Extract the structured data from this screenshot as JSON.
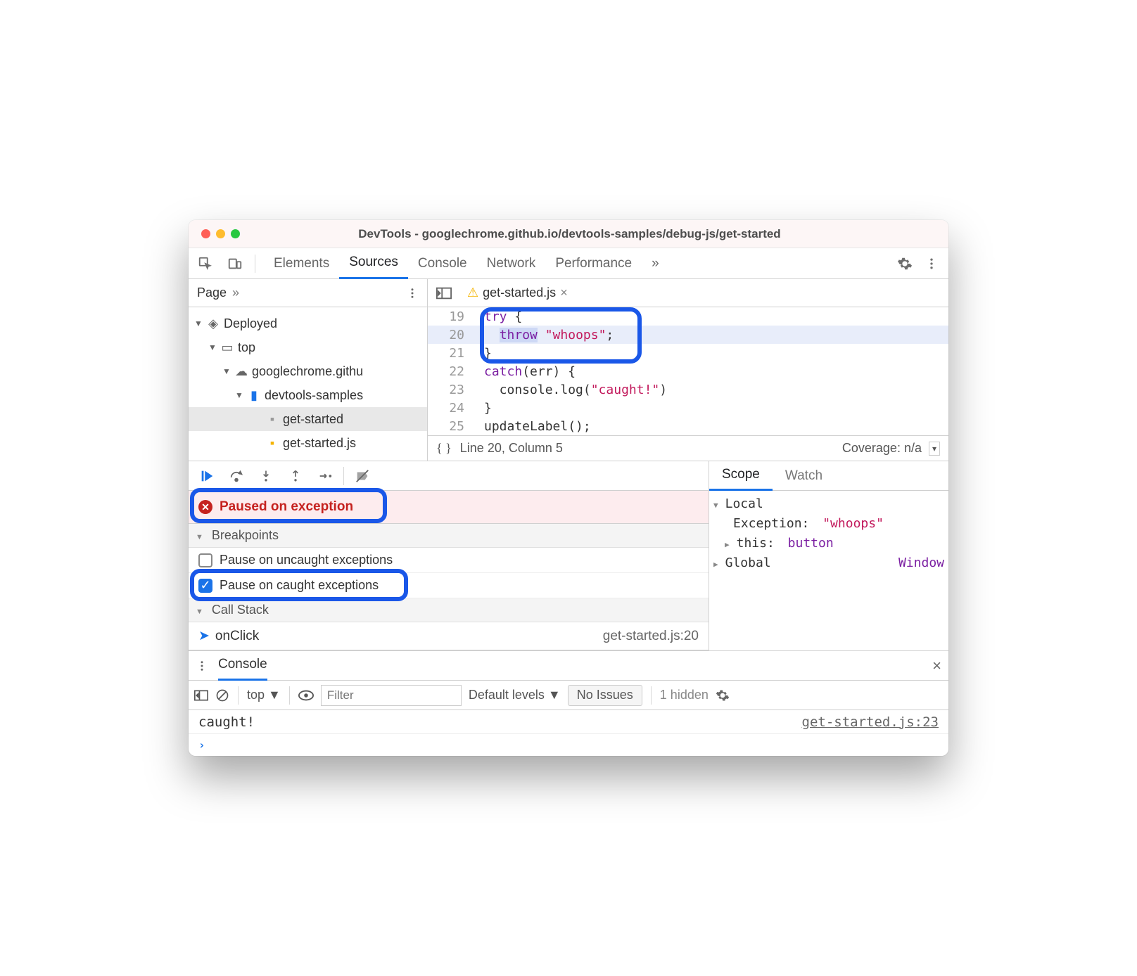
{
  "window_title": "DevTools - googlechrome.github.io/devtools-samples/debug-js/get-started",
  "main_tabs": [
    "Elements",
    "Sources",
    "Console",
    "Network",
    "Performance"
  ],
  "main_tabs_overflow": "»",
  "sidebar": {
    "head": "Page",
    "overflow": "»",
    "tree": {
      "deployed": "Deployed",
      "top": "top",
      "host": "googlechrome.githu",
      "folder": "devtools-samples",
      "file_html": "get-started",
      "file_js": "get-started.js"
    }
  },
  "editor": {
    "file": "get-started.js",
    "lines": [
      {
        "n": 19,
        "html": "<span class='tok-kw2'>try</span> {"
      },
      {
        "n": 20,
        "html": "&nbsp;&nbsp;<span class='tok-kw2' style='background:#cdd8f5'>throw</span> <span class='tok-str'>\"whoops\"</span>;",
        "hl": true
      },
      {
        "n": 21,
        "html": "}"
      },
      {
        "n": 22,
        "html": "<span class='tok-kw2'>catch</span>(err) {"
      },
      {
        "n": 23,
        "html": "&nbsp;&nbsp;console.log(<span class='tok-str'>\"caught!\"</span>)"
      },
      {
        "n": 24,
        "html": "}"
      },
      {
        "n": 25,
        "html": "updateLabel();"
      }
    ],
    "status_left": "Line 20, Column 5",
    "status_right": "Coverage: n/a"
  },
  "debugger": {
    "paused_msg": "Paused on exception",
    "breakpoints": {
      "title": "Breakpoints",
      "uncaught": "Pause on uncaught exceptions",
      "caught": "Pause on caught exceptions"
    },
    "callstack": {
      "title": "Call Stack",
      "frame": "onClick",
      "loc": "get-started.js:20"
    }
  },
  "scope": {
    "tabs": [
      "Scope",
      "Watch"
    ],
    "local": "Local",
    "exception_k": "Exception:",
    "exception_v": "\"whoops\"",
    "this_k": "this:",
    "this_v": "button",
    "global": "Global",
    "global_v": "Window"
  },
  "console": {
    "tab": "Console",
    "context": "top",
    "filter_ph": "Filter",
    "levels": "Default levels",
    "issues": "No Issues",
    "hidden": "1 hidden",
    "line": "caught!",
    "line_src": "get-started.js:23"
  }
}
